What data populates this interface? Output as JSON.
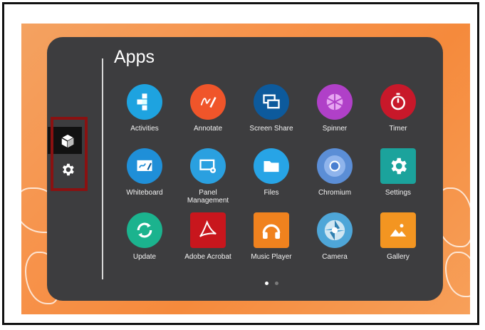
{
  "title": "Apps",
  "sidebar": [
    {
      "name": "apps-cube-icon",
      "selected": true
    },
    {
      "name": "settings-gear-icon",
      "selected": false
    }
  ],
  "apps": [
    {
      "label": "Activities",
      "icon": "activities-icon",
      "color": "#1ea3e0",
      "shape": "round"
    },
    {
      "label": "Annotate",
      "icon": "annotate-icon",
      "color": "#f0552a",
      "shape": "round"
    },
    {
      "label": "Screen Share",
      "icon": "screen-share-icon",
      "color": "#0d5a9c",
      "shape": "round"
    },
    {
      "label": "Spinner",
      "icon": "spinner-icon",
      "color": "#b040c8",
      "shape": "round"
    },
    {
      "label": "Timer",
      "icon": "timer-icon",
      "color": "#c8182a",
      "shape": "round"
    },
    {
      "label": "Whiteboard",
      "icon": "whiteboard-icon",
      "color": "#1f8fd8",
      "shape": "round"
    },
    {
      "label": "Panel\nManagement",
      "icon": "panel-management-icon",
      "color": "#2aa0e0",
      "shape": "round"
    },
    {
      "label": "Files",
      "icon": "files-icon",
      "color": "#27a4e6",
      "shape": "round"
    },
    {
      "label": "Chromium",
      "icon": "chromium-icon",
      "color": "#5b8ed6",
      "shape": "round"
    },
    {
      "label": "Settings",
      "icon": "settings-icon",
      "color": "#1ba39c",
      "shape": "sq"
    },
    {
      "label": "Update",
      "icon": "update-icon",
      "color": "#1bb38e",
      "shape": "round"
    },
    {
      "label": "Adobe Acrobat",
      "icon": "adobe-acrobat-icon",
      "color": "#c8161d",
      "shape": "sq"
    },
    {
      "label": "Music Player",
      "icon": "music-player-icon",
      "color": "#f0821e",
      "shape": "sq"
    },
    {
      "label": "Camera",
      "icon": "camera-icon",
      "color": "#4ea6d8",
      "shape": "round"
    },
    {
      "label": "Gallery",
      "icon": "gallery-icon",
      "color": "#f39521",
      "shape": "sq"
    }
  ],
  "pager": {
    "pages": 2,
    "current": 1
  }
}
